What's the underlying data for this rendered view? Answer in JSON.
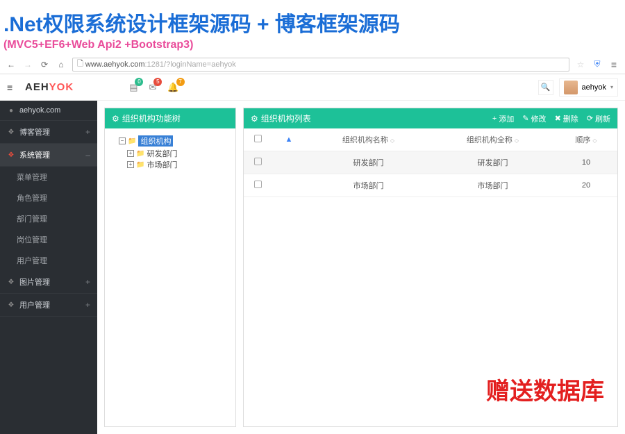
{
  "banner": {
    "title": ".Net权限系统设计框架源码 + 博客框架源码",
    "subtitle": "(MVC5+EF6+Web Api2 +Bootstrap3)"
  },
  "browser": {
    "url_host": "www.aehyok.com",
    "url_port": ":1281/",
    "url_query": "?loginName=aehyok"
  },
  "header": {
    "brand_a": "AEH",
    "brand_y": "YOK",
    "badges": {
      "inbox": "0",
      "mail": "5",
      "bell": "7"
    },
    "user": "aehyok"
  },
  "sidebar": [
    {
      "icon": "●",
      "label": "aehyok.com",
      "expand": ""
    },
    {
      "icon": "❖",
      "label": "博客管理",
      "expand": "+"
    },
    {
      "icon": "❖",
      "label": "系统管理",
      "expand": "–",
      "active": true,
      "subs": [
        "菜单管理",
        "角色管理",
        "部门管理",
        "岗位管理",
        "用户管理"
      ]
    },
    {
      "icon": "❖",
      "label": "图片管理",
      "expand": "+"
    },
    {
      "icon": "❖",
      "label": "用户管理",
      "expand": "+"
    }
  ],
  "tree": {
    "title": "组织机构功能树",
    "root": "组织机构",
    "children": [
      "研发部门",
      "市场部门"
    ]
  },
  "table": {
    "title": "组织机构列表",
    "actions": {
      "add": "添加",
      "edit": "修改",
      "del": "删除",
      "refresh": "刷新"
    },
    "cols": [
      "组织机构名称",
      "组织机构全称",
      "顺序"
    ],
    "rows": [
      {
        "name": "研发部门",
        "full": "研发部门",
        "order": "10"
      },
      {
        "name": "市场部门",
        "full": "市场部门",
        "order": "20"
      }
    ]
  },
  "gift": "赠送数据库"
}
